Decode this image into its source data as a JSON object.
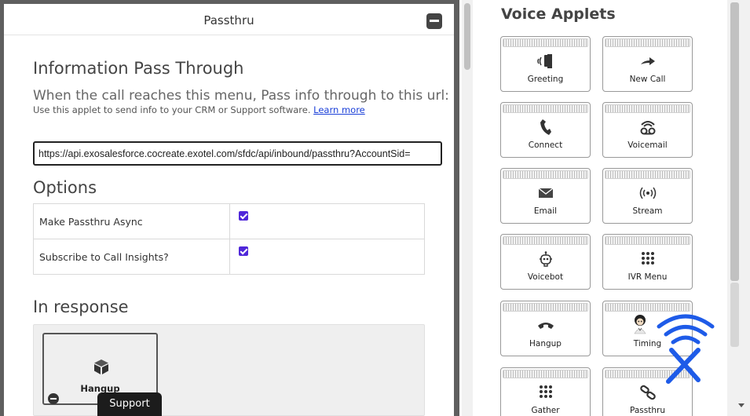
{
  "passthru_panel": {
    "title": "Passthru",
    "info_heading": "Information Pass Through",
    "description": "When the call reaches this menu, Pass info through to this url:",
    "help_text": "Use this applet to send info to your CRM or Support software.",
    "learn_more": "Learn more",
    "url_value": "https://api.exosalesforce.cocreate.exotel.com/sfdc/api/inbound/passthru?AccountSid=",
    "options_heading": "Options",
    "options": [
      {
        "label": "Make Passthru Async",
        "checked": true
      },
      {
        "label": "Subscribe to Call Insights?",
        "checked": true
      }
    ],
    "response_heading": "In response",
    "response_applet": {
      "label": "Hangup",
      "icon": "cube-icon"
    }
  },
  "support_button": "Support",
  "voice_applets": {
    "title": "Voice Applets",
    "items": [
      {
        "label": "Greeting",
        "icon": "greeting-speaker-icon"
      },
      {
        "label": "New Call",
        "icon": "new-call-arrow-icon"
      },
      {
        "label": "Connect",
        "icon": "phone-icon"
      },
      {
        "label": "Voicemail",
        "icon": "voicemail-icon"
      },
      {
        "label": "Email",
        "icon": "envelope-icon"
      },
      {
        "label": "Stream",
        "icon": "broadcast-icon"
      },
      {
        "label": "Voicebot",
        "icon": "robot-icon"
      },
      {
        "label": "IVR Menu",
        "icon": "keypad-icon"
      },
      {
        "label": "Hangup",
        "icon": "hangup-icon"
      },
      {
        "label": "Timing",
        "icon": "character-icon"
      },
      {
        "label": "Gather",
        "icon": "keypad-icon"
      },
      {
        "label": "Passthru",
        "icon": "link-icon"
      }
    ]
  },
  "colors": {
    "checkbox": "#4f27d9",
    "link": "#1a3fd8",
    "overlay_logo": "#1e5be8"
  }
}
